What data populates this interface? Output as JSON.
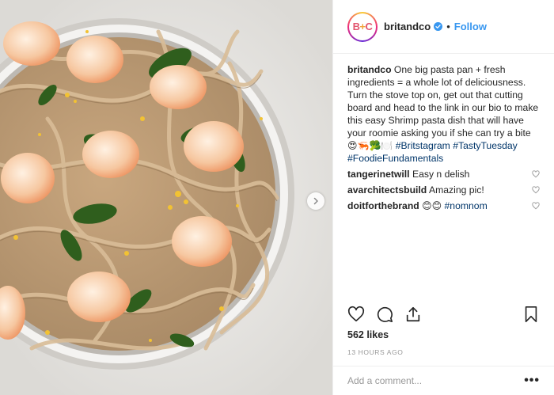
{
  "post": {
    "media_alt": "Shrimp pasta in a pan",
    "next_icon": "chevron-right-icon"
  },
  "header": {
    "avatar_text_b": "B",
    "avatar_text_plus": "+",
    "avatar_text_c": "C",
    "username": "britandco",
    "separator": "•",
    "follow_label": "Follow",
    "verified_icon": "verified-badge-icon"
  },
  "caption": {
    "username": "britandco",
    "text": "One big pasta pan + fresh ingredients = a whole lot of deliciousness. Turn the stove top on, get out that cutting board and head to the link in our bio to make this easy Shrimp pasta dish that will have your roomie asking you if she can try a bite",
    "emojis": "😍🦐🥦🍽️",
    "hashtags": [
      "#Britstagram",
      "#TastyTuesday",
      "#FoodieFundamentals"
    ]
  },
  "comments": [
    {
      "username": "tangerinetwill",
      "text": "Easy n delish",
      "hashtag": ""
    },
    {
      "username": "avarchitectsbuild",
      "text": "Amazing pic!",
      "hashtag": ""
    },
    {
      "username": "doitforthebrand",
      "text": "😊😊",
      "hashtag": "#nomnom"
    }
  ],
  "actions": {
    "like_icon": "heart-icon",
    "comment_icon": "comment-icon",
    "share_icon": "share-icon",
    "save_icon": "bookmark-icon"
  },
  "likes_text": "562 likes",
  "timestamp": "13 HOURS AGO",
  "add_comment": {
    "placeholder": "Add a comment...",
    "more_label": "•••"
  },
  "colors": {
    "link_blue": "#3897f0",
    "hashtag_blue": "#003569",
    "text": "#262626",
    "muted": "#999999"
  }
}
